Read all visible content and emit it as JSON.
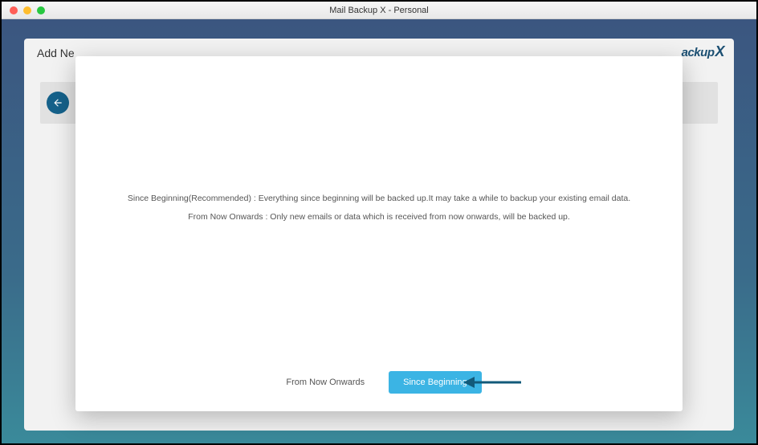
{
  "window": {
    "title": "Mail Backup X - Personal"
  },
  "header": {
    "page_title": "Add Ne",
    "brand_text": "ackup",
    "brand_x": "X"
  },
  "modal": {
    "line1": "Since Beginning(Recommended) : Everything since beginning will be backed up.It may take a while to backup your existing email data.",
    "line2": "From Now Onwards : Only new emails or data which is received from now onwards, will be backed up.",
    "buttons": {
      "from_now": "From Now Onwards",
      "since_beginning": "Since Beginning"
    }
  },
  "icons": {
    "back": "back-arrow",
    "annotation": "pointer-arrow"
  }
}
